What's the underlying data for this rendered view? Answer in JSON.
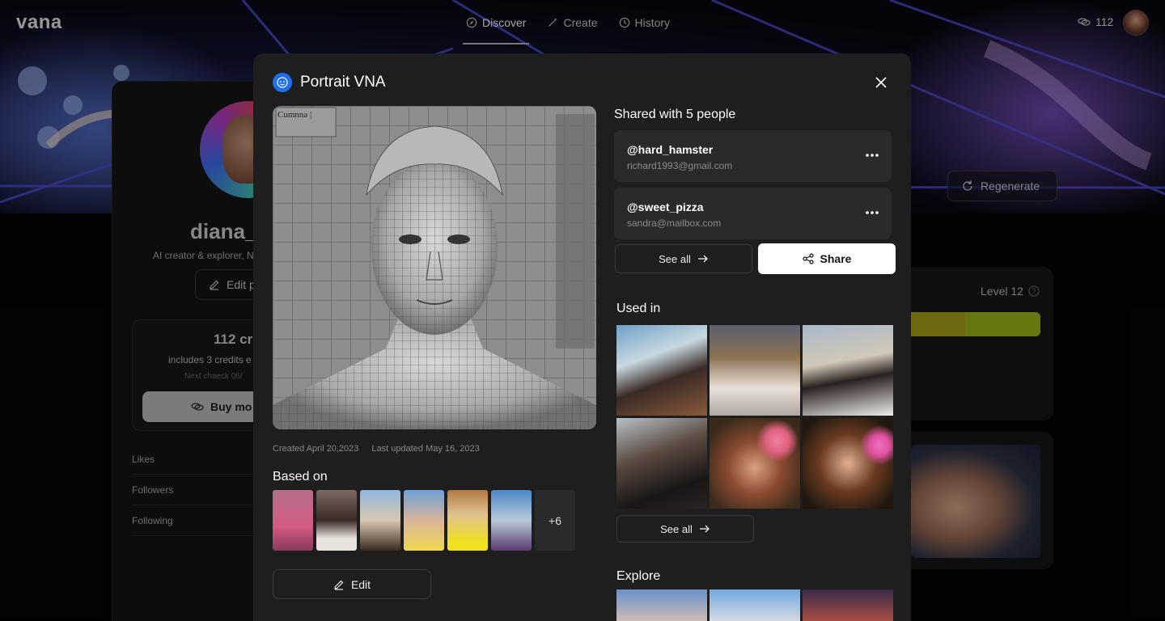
{
  "app": {
    "logo": "vana"
  },
  "nav": {
    "tabs": [
      {
        "label": "Discover",
        "icon": "compass-icon",
        "active": true
      },
      {
        "label": "Create",
        "icon": "wand-icon",
        "active": false
      },
      {
        "label": "History",
        "icon": "clock-icon",
        "active": false
      }
    ],
    "credits": "112"
  },
  "profile": {
    "name": "diana_",
    "bio": "AI creator & explorer, N",
    "edit_label": "Edit p",
    "credits_amount": "112 cre",
    "credits_sub": "includes 3 credits e",
    "credits_next": "Next chaeck 06/",
    "buy_label": "Buy mo",
    "stats": [
      "Likes",
      "Followers",
      "Following"
    ]
  },
  "right": {
    "regenerate_label": "Regenerate",
    "level_label": "Level 12"
  },
  "modal": {
    "title": "Portrait VNA",
    "created": "Created April 20,2023",
    "updated": "Last updated May 16, 2023",
    "based_on_title": "Based on",
    "based_on_more": "+6",
    "edit_label": "Edit",
    "shared_title": "Shared with 5 people",
    "shared_users": [
      {
        "handle": "@hard_hamster",
        "email": "richard1993@gmail.com"
      },
      {
        "handle": "@sweet_pizza",
        "email": "sandra@mailbox.com"
      }
    ],
    "see_all_label": "See all",
    "share_label": "Share",
    "used_in_title": "Used in",
    "used_in_see_all": "See all",
    "explore_title": "Explore",
    "image_overlay_text": "Cumnna |"
  },
  "colors": {
    "accent_blue": "#1f6ef0",
    "modal_bg": "#1e1e1e",
    "level_bar": "#a6a21a"
  }
}
